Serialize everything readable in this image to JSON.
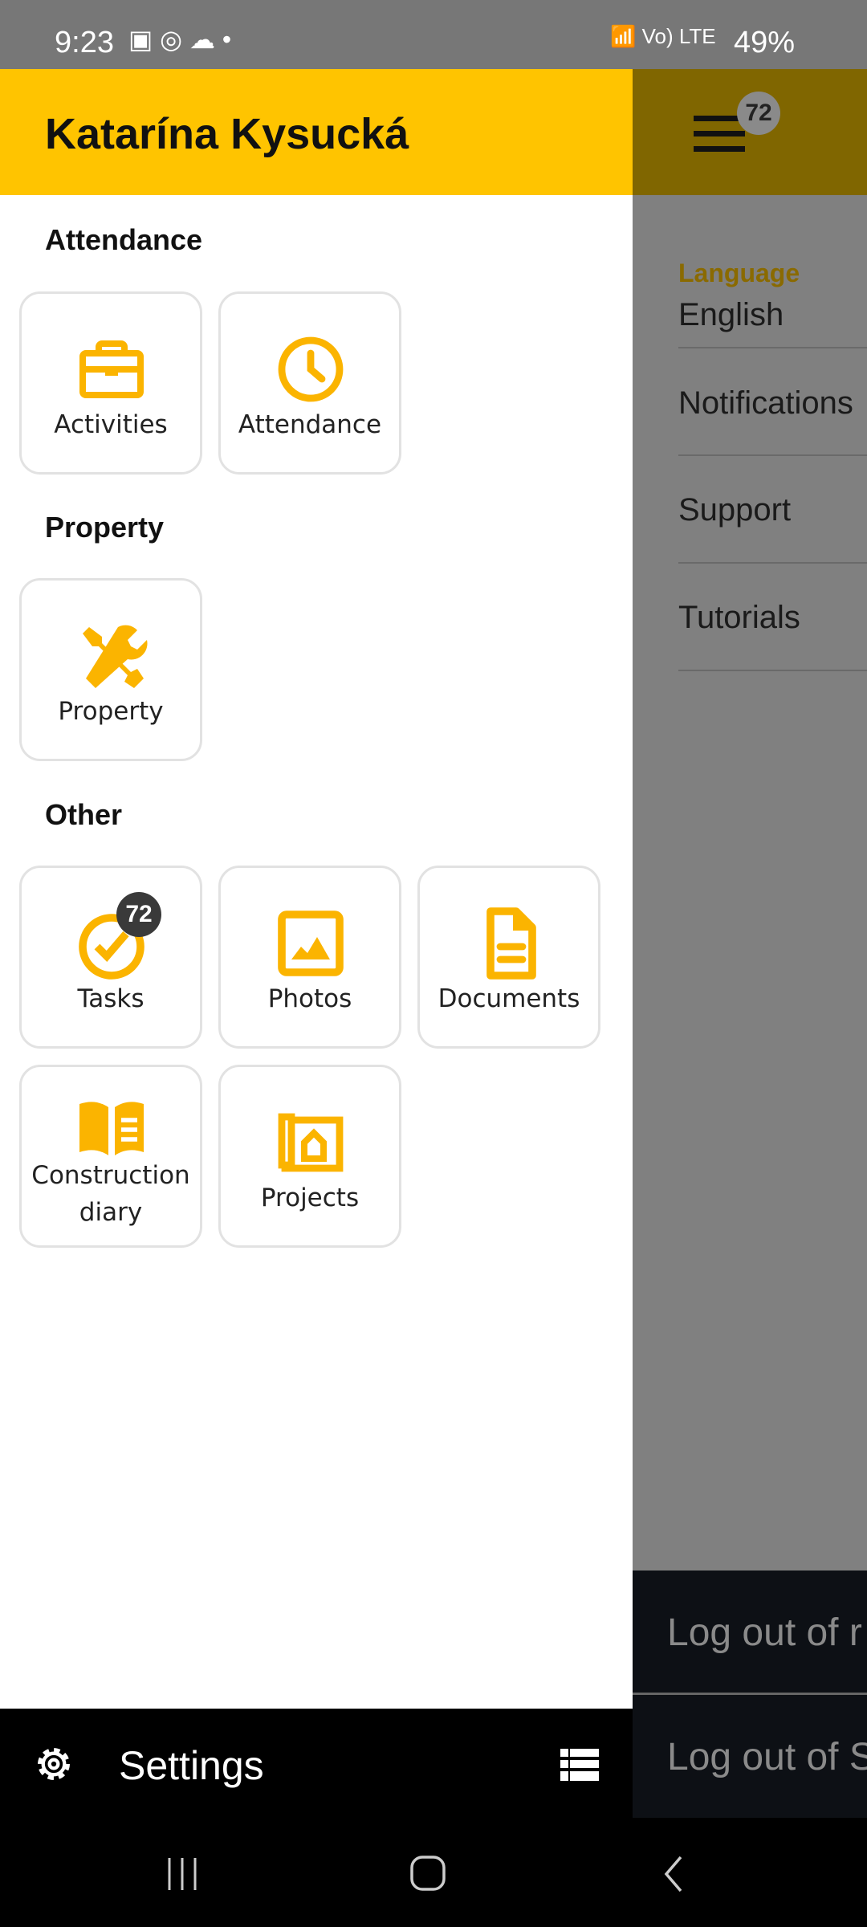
{
  "status_bar": {
    "time": "9:23",
    "battery": "49%",
    "network": "Vo) LTE"
  },
  "drawer": {
    "user_name": "Katarína Kysucká",
    "sections": [
      {
        "title": "Attendance",
        "items": [
          {
            "label": "Activities",
            "icon": "briefcase-icon"
          },
          {
            "label": "Attendance",
            "icon": "clock-icon"
          }
        ]
      },
      {
        "title": "Property",
        "items": [
          {
            "label": "Property",
            "icon": "tools-icon"
          }
        ]
      },
      {
        "title": "Other",
        "items": [
          {
            "label": "Tasks",
            "icon": "check-circle-icon",
            "badge": "72"
          },
          {
            "label": "Photos",
            "icon": "image-icon"
          },
          {
            "label": "Documents",
            "icon": "document-icon"
          },
          {
            "label": "Construction diary",
            "icon": "book-icon"
          },
          {
            "label": "Projects",
            "icon": "blueprint-icon"
          }
        ]
      }
    ],
    "footer": {
      "settings_label": "Settings"
    }
  },
  "background_screen": {
    "menu_badge": "72",
    "language_label": "Language",
    "language_value": "English",
    "items": [
      "Notifications",
      "Support",
      "Tutorials"
    ],
    "logout": [
      "Log out of r",
      "Log out of S"
    ]
  },
  "colors": {
    "accent": "#ffc400",
    "icon": "#fbb400"
  }
}
